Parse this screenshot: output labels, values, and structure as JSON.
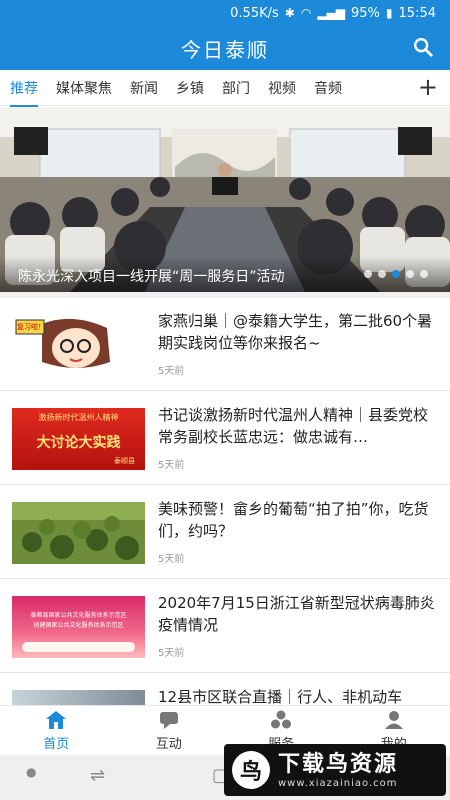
{
  "status_bar": {
    "speed": "0.55K/s",
    "battery": "95%",
    "time": "15:54"
  },
  "app": {
    "title": "今日泰顺"
  },
  "tabs": [
    {
      "label": "推荐",
      "active": true
    },
    {
      "label": "媒体聚焦"
    },
    {
      "label": "新闻"
    },
    {
      "label": "乡镇"
    },
    {
      "label": "部门"
    },
    {
      "label": "视频"
    },
    {
      "label": "音频"
    }
  ],
  "banner": {
    "caption": "陈永光深入项目一线开展“周一服务日”活动",
    "page_count": 5,
    "active_page": 3
  },
  "news": [
    {
      "headline": "家燕归巢｜@泰籍大学生，第二批60个暑期实践岗位等你来报名~",
      "time": "5天前"
    },
    {
      "headline": "书记谈激扬新时代温州人精神｜县委党校常务副校长蓝忠远：做忠诚有…",
      "time": "5天前"
    },
    {
      "headline": "美味预警！畲乡的葡萄“拍了拍”你，吃货们，约吗？",
      "time": "5天前"
    },
    {
      "headline": "2020年7月15日浙江省新型冠状病毒肺炎疫情情况",
      "time": "5天前"
    },
    {
      "headline": "12县市区联合直播｜行人、非机动车",
      "time": ""
    }
  ],
  "thumbs": {
    "cartoon_tag": "复习啦！",
    "banner_line1": "激扬新时代温州人精神",
    "banner_line2": "大讨论大实践",
    "banner_line3": "泰顺县",
    "culture_line1": "泰顺县国家公共文化服务体系示范区",
    "culture_line2": "创建国家公共文化服务体系示范区"
  },
  "bottom_nav": [
    {
      "label": "首页",
      "icon": "home-icon",
      "active": true
    },
    {
      "label": "互动",
      "icon": "chat-icon"
    },
    {
      "label": "服务",
      "icon": "cluster-icon"
    },
    {
      "label": "我的",
      "icon": "person-icon"
    }
  ],
  "watermark": {
    "brand": "下载鸟资源",
    "url": "www.xiazainiao.com"
  },
  "colors": {
    "primary": "#1c8ad9",
    "tab_active": "#1c8ad9",
    "separator": "#f0f0f0"
  }
}
